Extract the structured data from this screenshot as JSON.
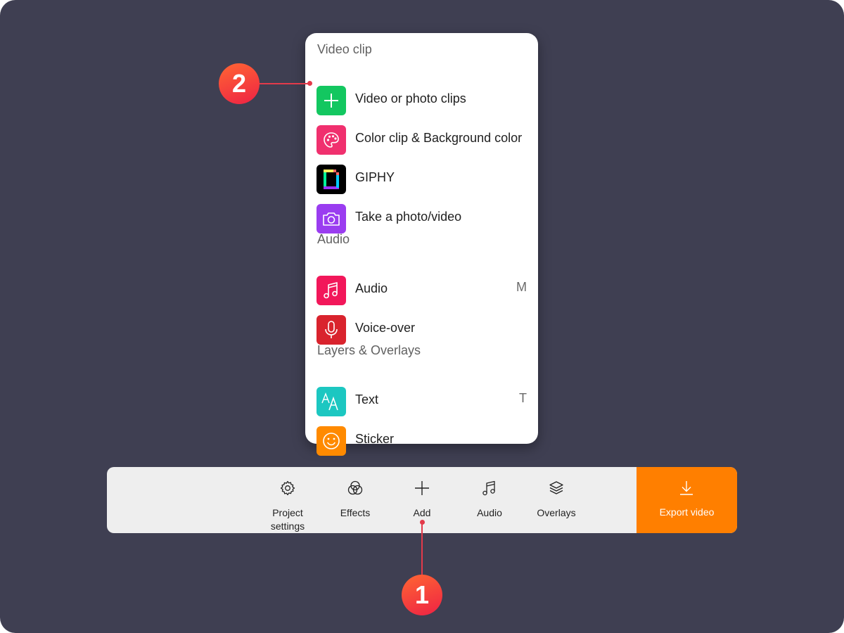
{
  "menu": {
    "sections": [
      {
        "heading": "Video clip",
        "items": [
          {
            "label": "Video or photo clips",
            "icon": "plus-icon",
            "color": "#13c760",
            "shortcut": ""
          },
          {
            "label": "Color clip & Background color",
            "icon": "palette-icon",
            "color": "#f0306e",
            "shortcut": ""
          },
          {
            "label": "GIPHY",
            "icon": "giphy-icon",
            "color": "#000000",
            "shortcut": ""
          },
          {
            "label": "Take a photo/video",
            "icon": "camera-icon",
            "color": "#9a3df0",
            "shortcut": ""
          }
        ]
      },
      {
        "heading": "Audio",
        "items": [
          {
            "label": "Audio",
            "icon": "music-note-icon",
            "color": "#f2175a",
            "shortcut": "M"
          },
          {
            "label": "Voice-over",
            "icon": "microphone-icon",
            "color": "#d9232d",
            "shortcut": ""
          }
        ]
      },
      {
        "heading": "Layers & Overlays",
        "items": [
          {
            "label": "Text",
            "icon": "text-icon",
            "color": "#1cc7c1",
            "shortcut": "T"
          },
          {
            "label": "Sticker",
            "icon": "smiley-icon",
            "color": "#ff8a00",
            "shortcut": ""
          }
        ]
      }
    ]
  },
  "toolbar": {
    "items": [
      {
        "label": "Project\nsettings",
        "icon": "gear-icon"
      },
      {
        "label": "Effects",
        "icon": "effects-icon"
      },
      {
        "label": "Add",
        "icon": "plus-icon"
      },
      {
        "label": "Audio",
        "icon": "music-note-icon"
      },
      {
        "label": "Overlays",
        "icon": "layers-icon"
      }
    ],
    "export": {
      "label": "Export video",
      "icon": "download-icon",
      "color": "#ff7f00"
    }
  },
  "callouts": {
    "first": "1",
    "second": "2",
    "color": "#e33a4a"
  }
}
